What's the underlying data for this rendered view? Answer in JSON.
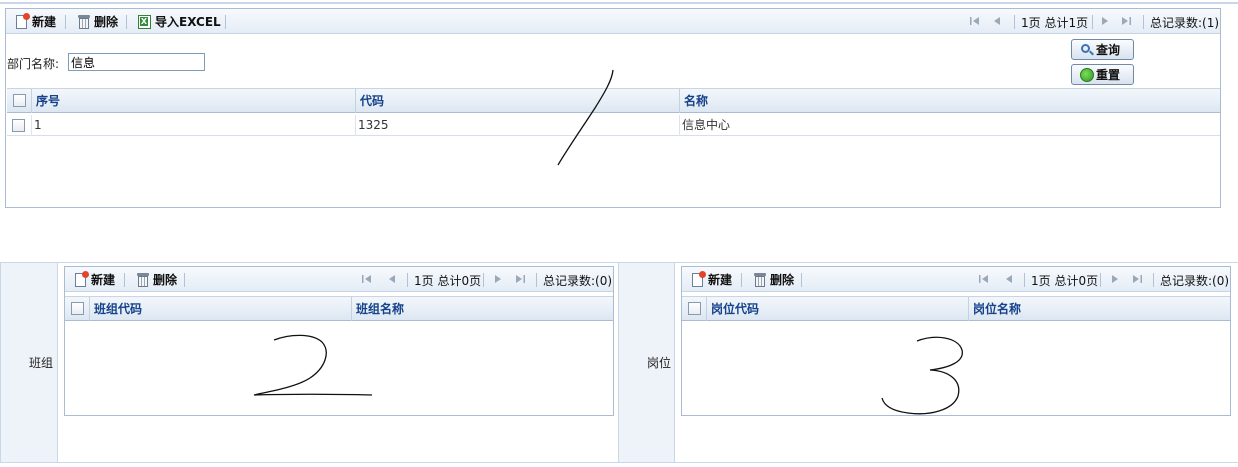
{
  "common": {
    "new_label": "新建",
    "delete_label": "删除"
  },
  "dept": {
    "toolbar": {
      "import_label": "导入EXCEL",
      "page_text": "1页 总计1页",
      "total_text": "总记录数:(1)"
    },
    "form": {
      "dept_name_label": "部门名称:",
      "dept_name_value": "信息",
      "query_label": "查询",
      "reset_label": "重置"
    },
    "grid": {
      "columns": [
        "序号",
        "代码",
        "名称"
      ],
      "rows": [
        [
          "1",
          "1325",
          "信息中心"
        ]
      ]
    }
  },
  "team": {
    "side_label": "班组",
    "toolbar": {
      "page_text": "1页 总计0页",
      "total_text": "总记录数:(0)"
    },
    "grid": {
      "columns": [
        "班组代码",
        "班组名称"
      ]
    }
  },
  "post": {
    "side_label": "岗位",
    "toolbar": {
      "page_text": "1页 总计0页",
      "total_text": "总记录数:(0)"
    },
    "grid": {
      "columns": [
        "岗位代码",
        "岗位名称"
      ]
    }
  }
}
